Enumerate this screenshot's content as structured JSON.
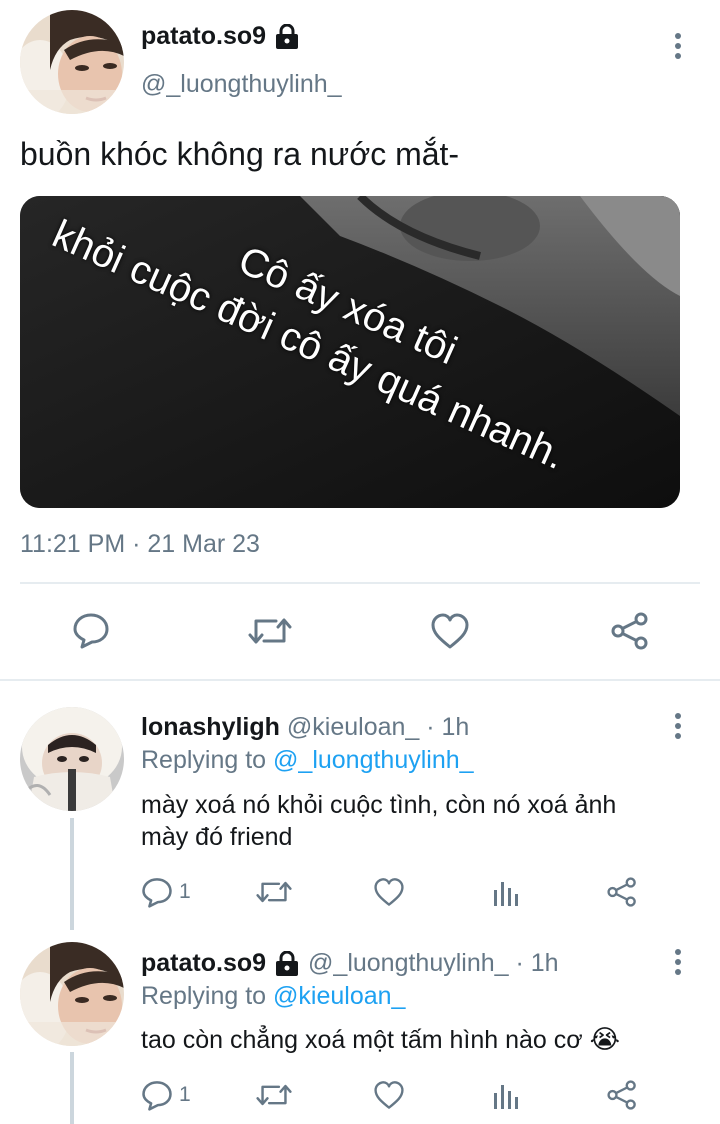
{
  "main_tweet": {
    "display_name": "patato.so9",
    "handle": "@_luongthuylinh_",
    "text": "buồn khóc không ra nước mắt-",
    "media_caption_line1": "Cô ấy xóa tôi",
    "media_caption_line2": "khỏi cuộc đời cô ấy quá nhanh.",
    "timestamp": "11:21 PM · 21 Mar 23",
    "icons": {
      "lock": "lock-icon",
      "more": "more-vertical-icon",
      "reply": "reply-icon",
      "retweet": "retweet-icon",
      "like": "heart-icon",
      "share": "share-icon"
    }
  },
  "replies": [
    {
      "display_name": "lonashyligh",
      "meta": "@kieuloan_ · 1h",
      "replying_prefix": "Replying to",
      "replying_to": "@_luongthuylinh_",
      "text_line1": "mày xoá nó khỏi cuộc tình, còn nó xoá ảnh",
      "text_line2": "mày đó friend",
      "reply_count": "1"
    },
    {
      "display_name": "patato.so9",
      "meta": "@_luongthuylinh_ · 1h",
      "replying_prefix": "Replying to",
      "replying_to": "@kieuloan_",
      "text_line1": "tao còn chẳng xoá một tấm hình nào cơ",
      "emoji": "😭",
      "reply_count": "1"
    }
  ],
  "colors": {
    "text": "#14171a",
    "muted": "#657786",
    "link": "#1da1f2",
    "divider": "#e6ecf0",
    "thread_line": "#ccd6dd"
  }
}
